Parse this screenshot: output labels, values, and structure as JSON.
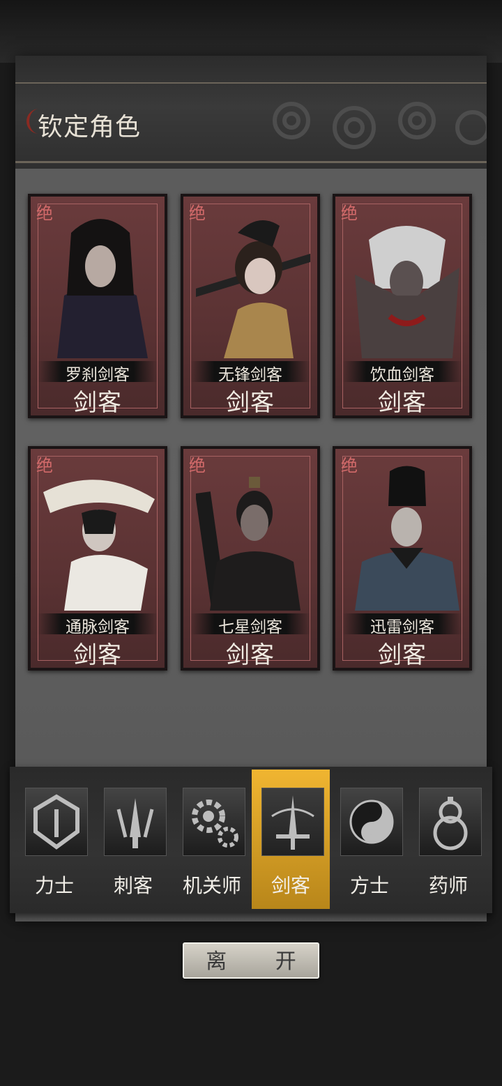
{
  "header": {
    "title": "钦定角色"
  },
  "cards": [
    {
      "badge": "绝",
      "name": "罗刹剑客",
      "class": "剑客"
    },
    {
      "badge": "绝",
      "name": "无锋剑客",
      "class": "剑客"
    },
    {
      "badge": "绝",
      "name": "饮血剑客",
      "class": "剑客"
    },
    {
      "badge": "绝",
      "name": "通脉剑客",
      "class": "剑客"
    },
    {
      "badge": "绝",
      "name": "七星剑客",
      "class": "剑客"
    },
    {
      "badge": "绝",
      "name": "迅雷剑客",
      "class": "剑客"
    }
  ],
  "tabs": [
    {
      "label": "力士",
      "icon": "shield-icon"
    },
    {
      "label": "刺客",
      "icon": "claw-icon"
    },
    {
      "label": "机关师",
      "icon": "gear-icon"
    },
    {
      "label": "剑客",
      "icon": "sword-icon",
      "active": true
    },
    {
      "label": "方士",
      "icon": "yin-yang-icon"
    },
    {
      "label": "药师",
      "icon": "gourd-icon"
    }
  ],
  "footer": {
    "leave_label": "离 开"
  },
  "colors": {
    "active_tab": "#e5a623",
    "badge": "#d26a6a",
    "card_bg": "#5a3233"
  }
}
